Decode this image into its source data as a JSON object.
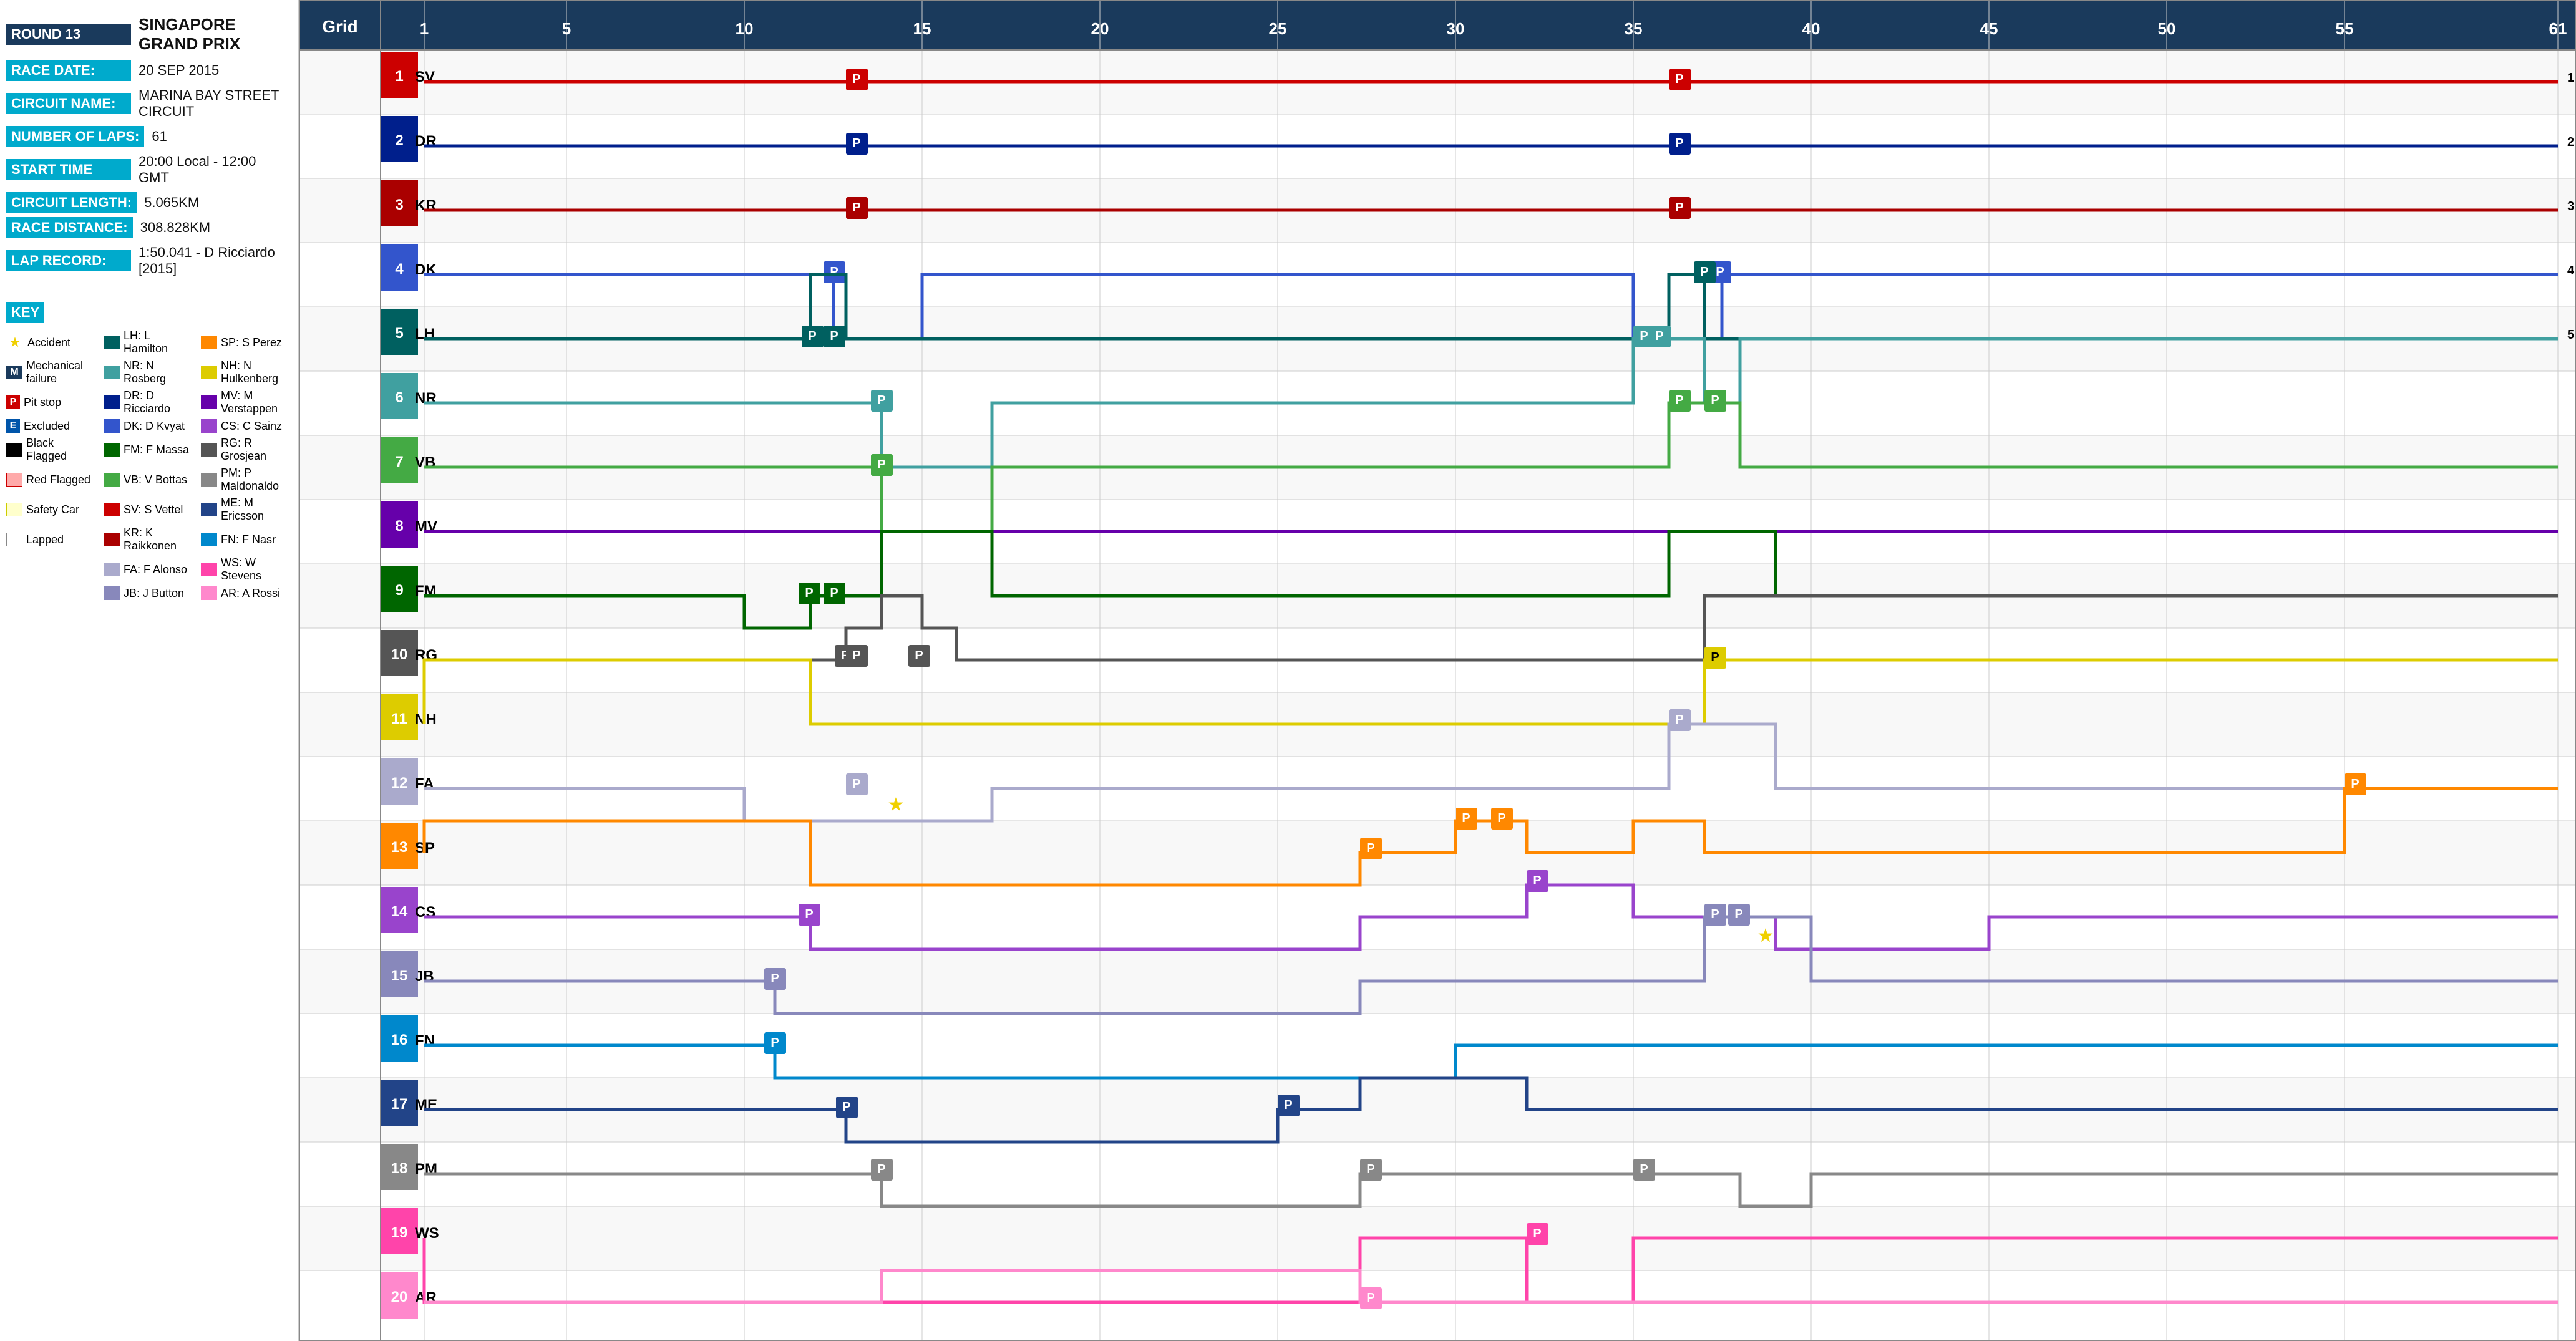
{
  "race": {
    "round_label": "ROUND 13",
    "round_value": "",
    "race_name": "SINGAPORE GRAND PRIX",
    "race_date_label": "RACE DATE:",
    "race_date_value": "20 SEP 2015",
    "circuit_label": "CIRCUIT NAME:",
    "circuit_value": "MARINA BAY STREET CIRCUIT",
    "laps_label": "NUMBER OF LAPS:",
    "laps_value": "61",
    "start_time_label": "START TIME",
    "start_time_value": "20:00 Local - 12:00 GMT",
    "circuit_length_label": "CIRCUIT LENGTH:",
    "circuit_length_value": "5.065KM",
    "race_distance_label": "RACE DISTANCE:",
    "race_distance_value": "308.828KM",
    "lap_record_label": "LAP RECORD:",
    "lap_record_value": "1:50.041 - D Ricciardo [2015]"
  },
  "key": {
    "title": "KEY",
    "items": [
      {
        "symbol": "star",
        "label": "Accident"
      },
      {
        "symbol": "M",
        "label": "Mechanical failure"
      },
      {
        "symbol": "P",
        "label": "Pit stop"
      },
      {
        "symbol": "E",
        "label": "Excluded"
      },
      {
        "symbol": "black_box",
        "label": "Black Flagged"
      },
      {
        "symbol": "red_box",
        "label": "Red Flagged"
      },
      {
        "symbol": "yellow_box",
        "label": "Safety Car"
      },
      {
        "symbol": "white_box",
        "label": "Lapped"
      }
    ],
    "drivers_col1": [
      {
        "code": "LH",
        "name": "L Hamilton",
        "color": "#006060"
      },
      {
        "code": "NR",
        "name": "N Rosberg",
        "color": "#40a0a0"
      },
      {
        "code": "DR",
        "name": "D Ricciardo",
        "color": "#001f8c"
      },
      {
        "code": "DK",
        "name": "D Kvyat",
        "color": "#3355cc"
      },
      {
        "code": "FM",
        "name": "F Massa",
        "color": "#006600"
      },
      {
        "code": "VB",
        "name": "V Bottas",
        "color": "#44aa44"
      },
      {
        "code": "SV",
        "name": "S Vettel",
        "color": "#cc0000"
      },
      {
        "code": "KR",
        "name": "K Raikkonen",
        "color": "#aa0000"
      },
      {
        "code": "FA",
        "name": "F Alonso",
        "color": "#aaaacc"
      },
      {
        "code": "JB",
        "name": "J Button",
        "color": "#8888bb"
      }
    ],
    "drivers_col2": [
      {
        "code": "SP",
        "name": "S Perez",
        "color": "#ff8800"
      },
      {
        "code": "NH",
        "name": "N Hulkenberg",
        "color": "#ddcc00"
      },
      {
        "code": "MV",
        "name": "M Verstappen",
        "color": "#6600aa"
      },
      {
        "code": "CS",
        "name": "C Sainz",
        "color": "#9944cc"
      },
      {
        "code": "RG",
        "name": "R Grosjean",
        "color": "#555555"
      },
      {
        "code": "PM",
        "name": "P Maldonaldo",
        "color": "#888888"
      },
      {
        "code": "ME",
        "name": "M Ericsson",
        "color": "#224488"
      },
      {
        "code": "FN",
        "name": "F Nasr",
        "color": "#0088cc"
      },
      {
        "code": "WS",
        "name": "W Stevens",
        "color": "#ff44aa"
      },
      {
        "code": "AR",
        "name": "A Rossi",
        "color": "#ff88cc"
      }
    ]
  },
  "chart": {
    "title": "Grid",
    "total_laps": 61,
    "lap_markers": [
      1,
      5,
      10,
      15,
      20,
      25,
      30,
      35,
      40,
      45,
      50,
      55,
      61
    ],
    "drivers": [
      {
        "pos": 1,
        "code": "SV",
        "color": "#cc0000",
        "grid": 1
      },
      {
        "pos": 2,
        "code": "DR",
        "color": "#001f8c",
        "grid": 2
      },
      {
        "pos": 3,
        "code": "KR",
        "color": "#aa0000",
        "grid": 3
      },
      {
        "pos": 4,
        "code": "DK",
        "color": "#3355cc",
        "grid": 4
      },
      {
        "pos": 5,
        "code": "LH",
        "color": "#006060",
        "grid": 5
      },
      {
        "pos": 6,
        "code": "NR",
        "color": "#40a0a0",
        "grid": 6
      },
      {
        "pos": 7,
        "code": "VB",
        "color": "#44aa44",
        "grid": 7
      },
      {
        "pos": 8,
        "code": "MV",
        "color": "#6600aa",
        "grid": 8
      },
      {
        "pos": 9,
        "code": "FM",
        "color": "#006600",
        "grid": 9
      },
      {
        "pos": 10,
        "code": "RG",
        "color": "#555555",
        "grid": 10
      },
      {
        "pos": 11,
        "code": "NH",
        "color": "#ddcc00",
        "grid": 11
      },
      {
        "pos": 12,
        "code": "FA",
        "color": "#aaaacc",
        "grid": 12
      },
      {
        "pos": 13,
        "code": "SP",
        "color": "#ff8800",
        "grid": 13
      },
      {
        "pos": 14,
        "code": "CS",
        "color": "#9944cc",
        "grid": 14
      },
      {
        "pos": 15,
        "code": "JB",
        "color": "#8888bb",
        "grid": 15
      },
      {
        "pos": 16,
        "code": "FN",
        "color": "#0088cc",
        "grid": 16
      },
      {
        "pos": 17,
        "code": "ME",
        "color": "#224488",
        "grid": 17
      },
      {
        "pos": 18,
        "code": "PM",
        "color": "#888888",
        "grid": 18
      },
      {
        "pos": 19,
        "code": "WS",
        "color": "#ff44aa",
        "grid": 19
      },
      {
        "pos": 20,
        "code": "AR",
        "color": "#ff88cc",
        "grid": 20
      }
    ]
  }
}
